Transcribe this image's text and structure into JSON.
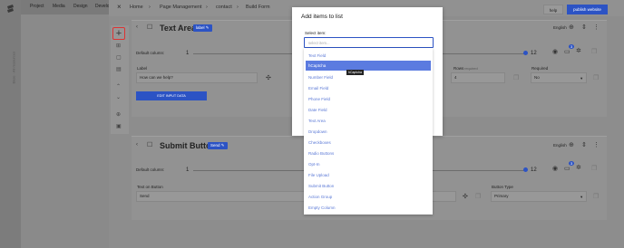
{
  "nav": {
    "items": [
      "Project",
      "Media",
      "Design",
      "Develo"
    ],
    "close": "×"
  },
  "sidebar": {
    "vertical_text": "Base · All resources"
  },
  "breadcrumb": [
    "Home",
    "Page Management",
    "contact",
    "Build Form"
  ],
  "header": {
    "help": "help",
    "publish": "publish website"
  },
  "card1": {
    "title": "Text Area",
    "tag": "label ✎",
    "default_label": "Default column:",
    "slider_min": "1",
    "slider_max": "12",
    "language": "English",
    "label_label": "Label",
    "label_value": "How can we help?",
    "edit_btn": "EDIT INPUT DATA",
    "rows_label": "Rows",
    "rows_required": "required",
    "rows_value": "4",
    "required_label": "Required",
    "required_value": "No"
  },
  "card2": {
    "title": "Submit Button",
    "tag": "Send ✎",
    "default_label": "Default column:",
    "slider_min": "1",
    "slider_max": "12",
    "language": "English",
    "text_label": "Text on Button",
    "text_value": "Send",
    "button_type_label": "Button Type",
    "button_type_value": "Primary"
  },
  "modal": {
    "title": "Add items to list",
    "select_label": "Select item:",
    "search_placeholder": "select item...",
    "options": [
      "Text Field",
      "hCaptcha",
      "Number Field",
      "Email Field",
      "Phone Field",
      "Date Field",
      "Text Area",
      "Dropdown",
      "Checkboxes",
      "Radio Buttons",
      "Opt-In",
      "File Upload",
      "Submit Button",
      "Action Group",
      "Empty Column"
    ],
    "highlighted": "hCaptcha",
    "tooltip": "hCaptcha"
  },
  "badges": {
    "card1": "3",
    "card2": "3"
  },
  "colors": {
    "accent": "#2c53c4",
    "highlight": "#5b7be0",
    "link": "#5b79d6"
  }
}
